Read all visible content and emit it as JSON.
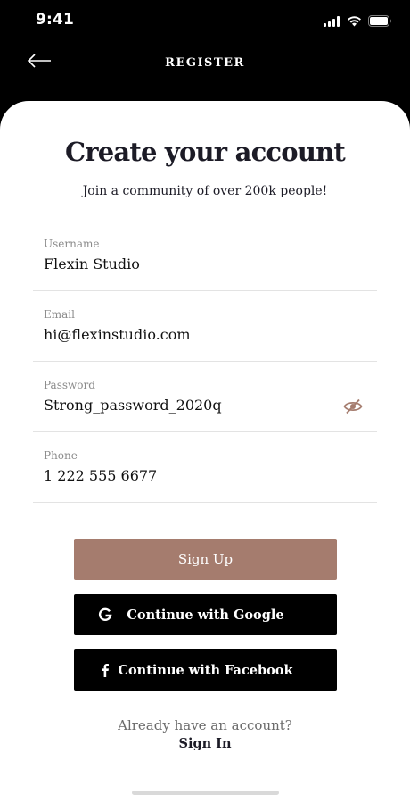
{
  "status_bar": {
    "time": "9:41",
    "icons": [
      "cellular-signal-icon",
      "wifi-icon",
      "battery-icon"
    ]
  },
  "nav": {
    "title": "REGISTER",
    "back_icon": "arrow-left-icon"
  },
  "form": {
    "title": "Create your account",
    "subtitle": "Join a community of over 200k people!",
    "fields": [
      {
        "label": "Username",
        "value": "Flexin Studio"
      },
      {
        "label": "Email",
        "value": "hi@flexinstudio.com"
      },
      {
        "label": "Password",
        "value": "Strong_password_2020q",
        "toggle_icon": "eye-slash-icon"
      },
      {
        "label": "Phone",
        "value": "1 222 555 6677"
      }
    ]
  },
  "buttons": {
    "sign_up": "Sign Up",
    "google": "Continue with Google",
    "facebook": "Continue with Facebook"
  },
  "footer": {
    "prompt": "Already have an account?",
    "link": "Sign In"
  },
  "colors": {
    "accent": "#a57c6e",
    "dark": "#000000",
    "background": "#ffffff",
    "divider": "#e3e3e3"
  }
}
